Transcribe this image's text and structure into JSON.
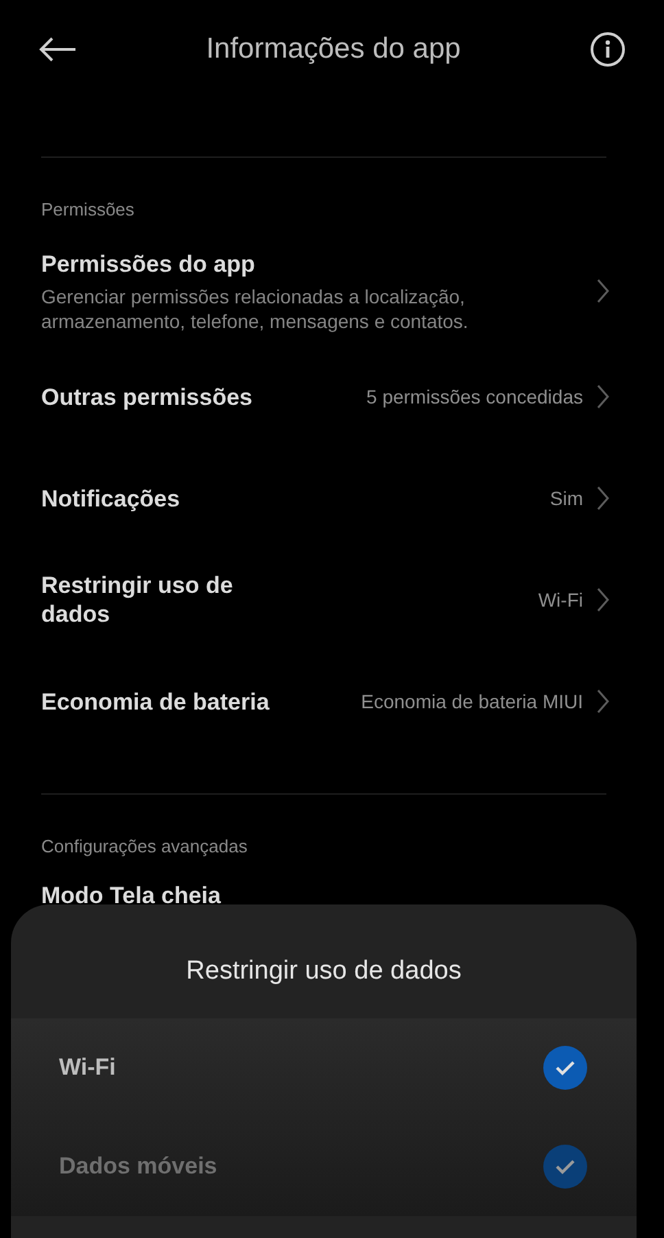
{
  "header": {
    "title": "Informações do app"
  },
  "sections": [
    {
      "label": "Permissões",
      "items": [
        {
          "title": "Permissões do app",
          "subtitle": "Gerenciar permissões relacionadas a localização, armazenamento, telefone, mensagens e contatos."
        },
        {
          "title": "Outras permissões",
          "value": "5 permissões concedidas"
        },
        {
          "title": "Notificações",
          "value": "Sim"
        },
        {
          "title": "Restringir uso de dados",
          "value": "Wi-Fi"
        },
        {
          "title": "Economia de bateria",
          "value": "Economia de bateria MIUI"
        }
      ]
    },
    {
      "label": "Configurações avançadas",
      "items": [
        {
          "title": "Modo Tela cheia"
        }
      ]
    }
  ],
  "sheet": {
    "title": "Restringir uso de dados",
    "options": [
      {
        "label": "Wi-Fi",
        "checked": true,
        "disabled": false
      },
      {
        "label": "Dados móveis",
        "checked": true,
        "disabled": true
      }
    ]
  }
}
